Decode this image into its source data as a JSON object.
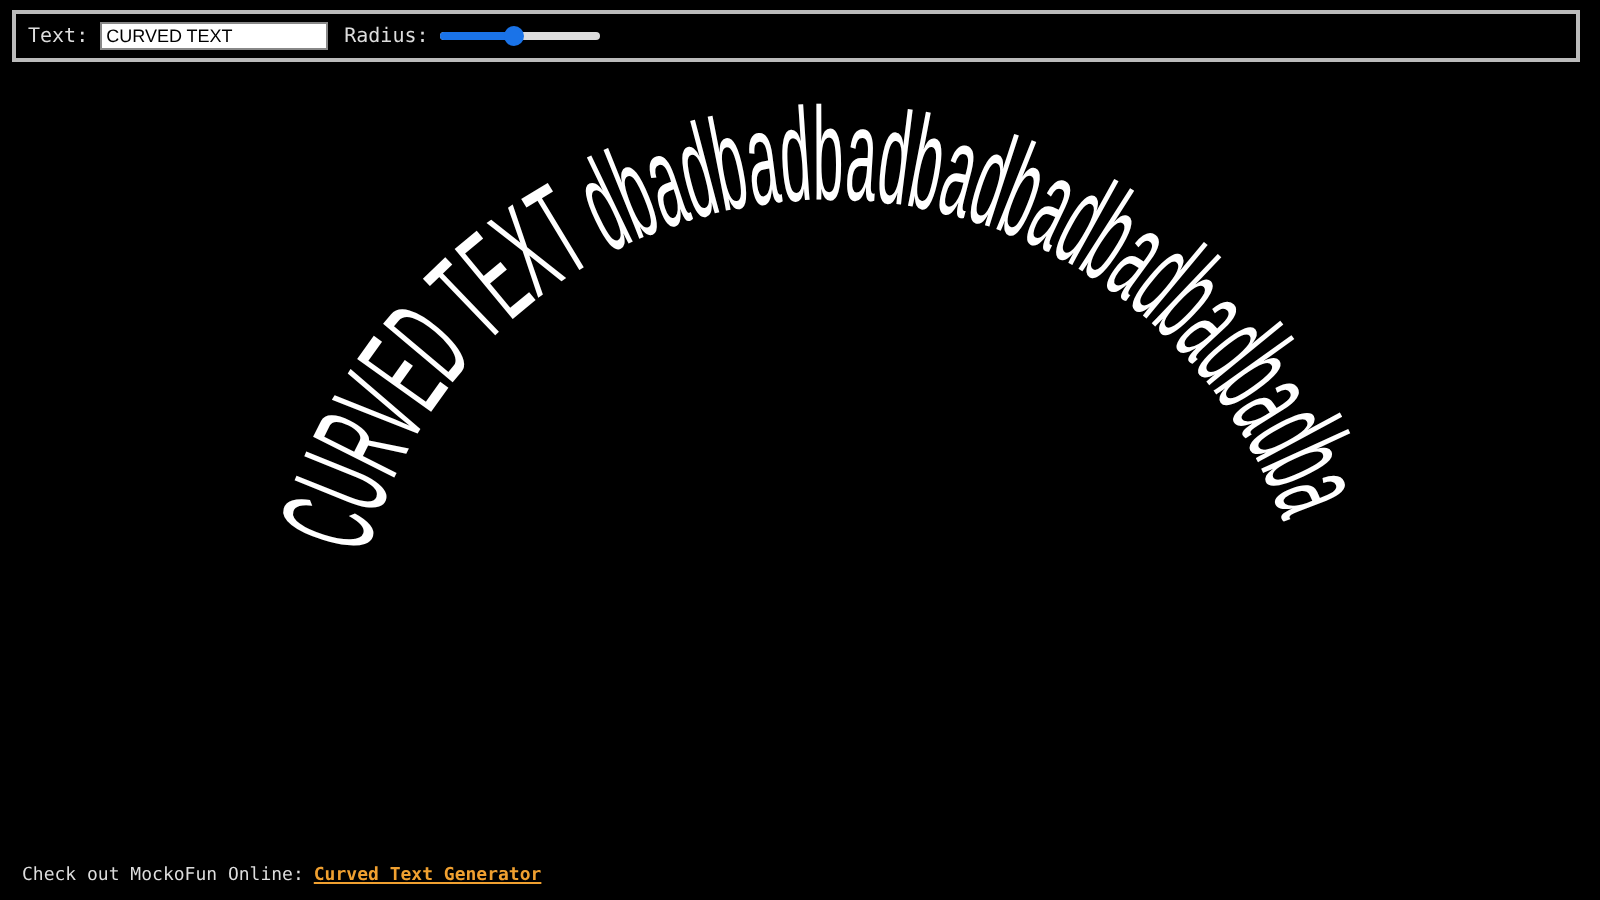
{
  "controls": {
    "text_label": "Text:",
    "text_value": "CURVED TEXT",
    "radius_label": "Radius:",
    "radius": {
      "level": 0.46
    }
  },
  "curved_text": "CURVED TEXT dbadbadbadbadbadbadbadbadba",
  "footer": {
    "text": "Check out MockoFun Online:",
    "link": "Curved Text Generator"
  }
}
